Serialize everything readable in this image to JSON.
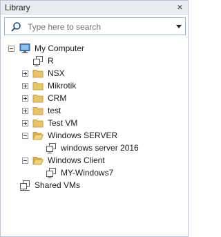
{
  "panel": {
    "title": "Library",
    "close_glyph": "×"
  },
  "search": {
    "placeholder": "Type here to search",
    "value": "",
    "icon": "magnifier-icon",
    "dropdown_icon": "triangle-down-icon"
  },
  "tree": {
    "root": {
      "label": "My Computer",
      "icon": "monitor-icon",
      "state": "expanded"
    },
    "items": [
      {
        "label": "R",
        "icon": "vm-icon",
        "type": "vm"
      },
      {
        "label": "NSX",
        "icon": "folder-icon",
        "type": "folder",
        "state": "collapsed"
      },
      {
        "label": "Mikrotik",
        "icon": "folder-icon",
        "type": "folder",
        "state": "collapsed"
      },
      {
        "label": "CRM",
        "icon": "folder-icon",
        "type": "folder",
        "state": "collapsed"
      },
      {
        "label": "test",
        "icon": "folder-icon",
        "type": "folder",
        "state": "collapsed"
      },
      {
        "label": "Test VM",
        "icon": "folder-icon",
        "type": "folder",
        "state": "collapsed"
      },
      {
        "label": "Windows SERVER",
        "icon": "folder-icon",
        "type": "folder",
        "state": "expanded"
      },
      {
        "label": "windows server 2016",
        "icon": "vm-icon",
        "type": "vm"
      },
      {
        "label": "Windows Client",
        "icon": "folder-icon",
        "type": "folder",
        "state": "expanded"
      },
      {
        "label": "MY-Windows7",
        "icon": "vm-icon",
        "type": "vm"
      }
    ],
    "shared": {
      "label": "Shared VMs",
      "icon": "shared-vms-icon"
    }
  },
  "colors": {
    "folder": "#e8c46a",
    "folder_edge": "#c8a044",
    "border": "#b9c3cf",
    "titlebar_bg": "#e9edf1"
  }
}
